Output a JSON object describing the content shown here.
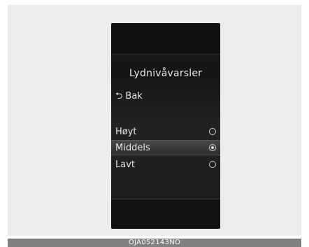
{
  "menu": {
    "title": "Lydnivåvarsler",
    "back_label": "Bak",
    "back_icon": "return-arrow-icon",
    "options": [
      {
        "label": "Høyt",
        "selected": false
      },
      {
        "label": "Middels",
        "selected": true
      },
      {
        "label": "Lavt",
        "selected": false
      }
    ]
  },
  "caption": "OJA052143NO"
}
